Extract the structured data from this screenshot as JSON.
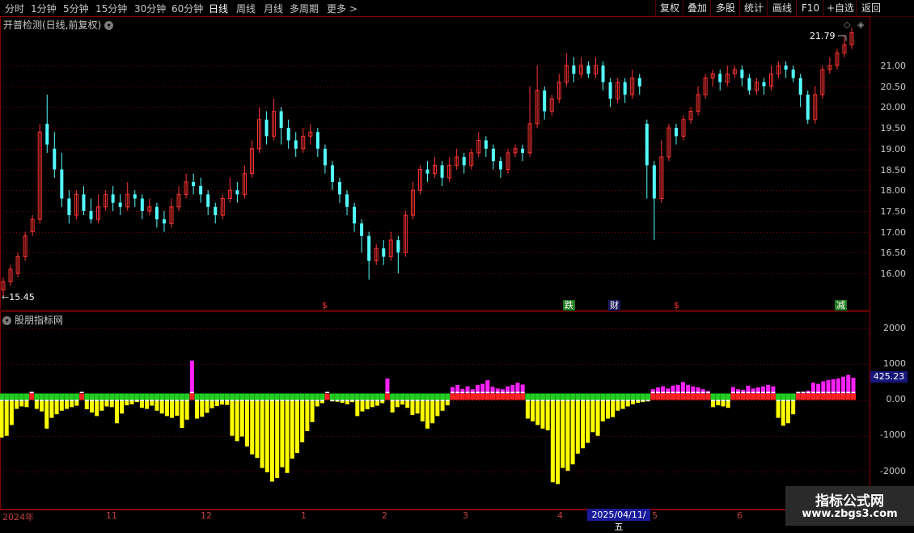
{
  "toolbar": {
    "periods": [
      "分时",
      "1分钟",
      "5分钟",
      "15分钟",
      "30分钟",
      "60分钟",
      "日线",
      "周线",
      "月线",
      "多周期",
      "更多 >"
    ],
    "active_period": "日线",
    "right_buttons": [
      "复权",
      "叠加",
      "多股",
      "统计",
      "画线",
      "F10",
      "+自选",
      "返回"
    ]
  },
  "main_panel": {
    "title": "开普检测(日线,前复权)",
    "high_label": "21.79",
    "low_label": "15.45",
    "price_axis": [
      "21.00",
      "20.50",
      "20.00",
      "19.50",
      "19.00",
      "18.50",
      "18.00",
      "17.50",
      "17.00",
      "16.50",
      "16.00"
    ],
    "markers": [
      {
        "text": "$",
        "color": "#ff3030",
        "bg": "none"
      },
      {
        "text": "跌",
        "color": "#ffffff",
        "bg": "#1f7a1f"
      },
      {
        "text": "财",
        "color": "#ffffff",
        "bg": "#1a1a5a"
      },
      {
        "text": "$",
        "color": "#ff3030",
        "bg": "none"
      },
      {
        "text": "减",
        "color": "#ffffff",
        "bg": "#1f7a1f"
      }
    ]
  },
  "sub_panel": {
    "title": "股朋指标网",
    "axis": [
      "2000",
      "1000",
      "0.00",
      "-1000",
      "-2000"
    ],
    "current_value": "425.23"
  },
  "date_axis": {
    "labels": [
      "2024年",
      "11",
      "12",
      "1",
      "2",
      "3",
      "4",
      "5",
      "6"
    ],
    "highlight": "2025/04/11/五"
  },
  "watermark": {
    "line1": "指标公式网",
    "line2": "www.zbgs3.com"
  },
  "colors": {
    "up": "#ff3333",
    "down": "#54ffff",
    "positive_bar": "#ff22ff",
    "negative_bar": "#ffff00",
    "band_red": "#ff2222",
    "band_green": "#22cc22",
    "grid": "#7a0000"
  },
  "chart_data": [
    {
      "type": "candlestick",
      "title": "开普检测(日线,前复权)",
      "ylim": [
        15.5,
        22.1
      ],
      "candles": [
        [
          15.6,
          15.8,
          15.45,
          15.9
        ],
        [
          15.8,
          16.1,
          15.7,
          16.2
        ],
        [
          16.0,
          16.4,
          15.9,
          16.5
        ],
        [
          16.4,
          16.9,
          16.3,
          17.0
        ],
        [
          17.0,
          17.3,
          16.9,
          17.4
        ],
        [
          17.3,
          19.4,
          17.2,
          19.6
        ],
        [
          19.6,
          19.1,
          18.9,
          20.3
        ],
        [
          19.0,
          18.5,
          18.3,
          19.4
        ],
        [
          18.5,
          17.8,
          17.6,
          18.9
        ],
        [
          17.8,
          17.4,
          17.2,
          18.0
        ],
        [
          17.4,
          17.9,
          17.3,
          18.0
        ],
        [
          17.9,
          17.5,
          17.4,
          18.1
        ],
        [
          17.5,
          17.3,
          17.2,
          17.8
        ],
        [
          17.3,
          17.6,
          17.2,
          17.9
        ],
        [
          17.6,
          17.9,
          17.5,
          18.0
        ],
        [
          17.9,
          17.7,
          17.5,
          18.1
        ],
        [
          17.7,
          17.6,
          17.4,
          17.9
        ],
        [
          17.6,
          17.9,
          17.5,
          18.2
        ],
        [
          17.9,
          17.8,
          17.6,
          18.0
        ],
        [
          17.8,
          17.5,
          17.3,
          17.9
        ],
        [
          17.5,
          17.6,
          17.4,
          17.8
        ],
        [
          17.6,
          17.3,
          17.1,
          17.7
        ],
        [
          17.3,
          17.2,
          17.0,
          17.5
        ],
        [
          17.2,
          17.6,
          17.1,
          17.8
        ],
        [
          17.6,
          17.9,
          17.5,
          18.1
        ],
        [
          17.9,
          18.2,
          17.8,
          18.4
        ],
        [
          18.2,
          18.1,
          17.9,
          18.4
        ],
        [
          18.1,
          17.9,
          17.7,
          18.3
        ],
        [
          17.9,
          17.6,
          17.4,
          18.0
        ],
        [
          17.6,
          17.4,
          17.2,
          17.7
        ],
        [
          17.4,
          17.8,
          17.3,
          17.9
        ],
        [
          17.8,
          18.0,
          17.7,
          18.3
        ],
        [
          18.0,
          17.9,
          17.7,
          18.2
        ],
        [
          17.9,
          18.4,
          17.8,
          18.6
        ],
        [
          18.4,
          19.0,
          18.3,
          19.2
        ],
        [
          19.0,
          19.7,
          18.9,
          20.0
        ],
        [
          19.7,
          19.3,
          19.1,
          19.9
        ],
        [
          19.3,
          19.9,
          19.2,
          20.2
        ],
        [
          19.9,
          19.5,
          19.1,
          20.0
        ],
        [
          19.5,
          19.2,
          19.0,
          19.7
        ],
        [
          19.2,
          19.0,
          18.8,
          19.4
        ],
        [
          19.0,
          19.3,
          18.9,
          19.5
        ],
        [
          19.3,
          19.4,
          19.1,
          19.6
        ],
        [
          19.4,
          19.0,
          18.8,
          19.5
        ],
        [
          19.0,
          18.6,
          18.4,
          19.1
        ],
        [
          18.6,
          18.2,
          18.0,
          18.7
        ],
        [
          18.2,
          17.9,
          17.7,
          18.3
        ],
        [
          17.9,
          17.6,
          17.4,
          18.0
        ],
        [
          17.6,
          17.2,
          17.0,
          17.7
        ],
        [
          17.2,
          16.9,
          16.5,
          17.3
        ],
        [
          16.9,
          16.3,
          15.85,
          17.0
        ],
        [
          16.3,
          16.6,
          16.2,
          16.7
        ],
        [
          16.6,
          16.4,
          16.2,
          16.8
        ],
        [
          16.4,
          16.8,
          16.3,
          17.0
        ],
        [
          16.8,
          16.5,
          16.0,
          16.9
        ],
        [
          16.5,
          17.4,
          16.4,
          17.5
        ],
        [
          17.4,
          18.0,
          17.3,
          18.2
        ],
        [
          18.0,
          18.5,
          17.9,
          18.6
        ],
        [
          18.5,
          18.4,
          18.2,
          18.7
        ],
        [
          18.4,
          18.6,
          18.3,
          18.8
        ],
        [
          18.6,
          18.3,
          18.1,
          18.7
        ],
        [
          18.3,
          18.6,
          18.2,
          18.8
        ],
        [
          18.6,
          18.8,
          18.5,
          19.0
        ],
        [
          18.8,
          18.6,
          18.4,
          18.9
        ],
        [
          18.6,
          18.9,
          18.5,
          19.0
        ],
        [
          18.9,
          19.2,
          18.8,
          19.4
        ],
        [
          19.2,
          19.0,
          18.8,
          19.3
        ],
        [
          19.0,
          18.7,
          18.5,
          19.1
        ],
        [
          18.7,
          18.5,
          18.3,
          18.8
        ],
        [
          18.5,
          18.9,
          18.4,
          19.0
        ],
        [
          18.9,
          19.0,
          18.8,
          19.1
        ],
        [
          19.0,
          18.9,
          18.7,
          19.1
        ],
        [
          18.9,
          19.6,
          18.8,
          20.5
        ],
        [
          19.6,
          20.4,
          19.5,
          21.0
        ],
        [
          20.4,
          19.9,
          19.7,
          20.5
        ],
        [
          19.9,
          20.2,
          19.8,
          20.3
        ],
        [
          20.2,
          20.6,
          20.1,
          20.8
        ],
        [
          20.6,
          21.0,
          20.5,
          21.3
        ],
        [
          21.0,
          20.8,
          20.6,
          21.2
        ],
        [
          20.8,
          21.0,
          20.7,
          21.2
        ],
        [
          21.0,
          20.8,
          20.7,
          21.1
        ],
        [
          20.8,
          21.0,
          20.7,
          21.2
        ],
        [
          21.0,
          20.6,
          20.4,
          21.1
        ],
        [
          20.6,
          20.2,
          20.0,
          20.7
        ],
        [
          20.2,
          20.6,
          20.1,
          20.7
        ],
        [
          20.6,
          20.3,
          20.1,
          20.7
        ],
        [
          20.3,
          20.7,
          20.2,
          20.9
        ],
        [
          20.7,
          20.5,
          20.3,
          20.8
        ],
        [
          19.6,
          18.6,
          17.8,
          19.7
        ],
        [
          18.6,
          17.8,
          16.8,
          18.7
        ],
        [
          17.8,
          18.8,
          17.7,
          19.2
        ],
        [
          18.8,
          19.5,
          18.7,
          19.6
        ],
        [
          19.5,
          19.3,
          19.1,
          19.6
        ],
        [
          19.3,
          19.7,
          19.2,
          19.8
        ],
        [
          19.7,
          19.9,
          19.6,
          20.0
        ],
        [
          19.9,
          20.3,
          19.8,
          20.5
        ],
        [
          20.3,
          20.7,
          20.2,
          20.8
        ],
        [
          20.7,
          20.8,
          20.5,
          20.9
        ],
        [
          20.8,
          20.6,
          20.4,
          20.9
        ],
        [
          20.6,
          20.8,
          20.5,
          21.0
        ],
        [
          20.8,
          20.9,
          20.7,
          21.0
        ],
        [
          20.9,
          20.7,
          20.5,
          21.0
        ],
        [
          20.7,
          20.4,
          20.3,
          20.8
        ],
        [
          20.4,
          20.6,
          20.3,
          20.7
        ],
        [
          20.6,
          20.5,
          20.3,
          20.7
        ],
        [
          20.5,
          20.8,
          20.4,
          21.0
        ],
        [
          20.8,
          21.0,
          20.7,
          21.1
        ],
        [
          21.0,
          20.9,
          20.7,
          21.1
        ],
        [
          20.9,
          20.7,
          20.6,
          21.0
        ],
        [
          20.7,
          20.3,
          20.0,
          20.8
        ],
        [
          20.3,
          19.7,
          19.6,
          20.4
        ],
        [
          19.7,
          20.3,
          19.6,
          20.5
        ],
        [
          20.3,
          20.9,
          20.2,
          21.0
        ],
        [
          20.9,
          21.0,
          20.8,
          21.2
        ],
        [
          21.0,
          21.3,
          20.9,
          21.4
        ],
        [
          21.3,
          21.5,
          21.2,
          21.7
        ],
        [
          21.5,
          21.79,
          21.4,
          21.9
        ]
      ]
    },
    {
      "type": "bar",
      "title": "股朋指标网",
      "ylim": [
        -2400,
        2100
      ],
      "values": [
        -1050,
        -1000,
        -700,
        -250,
        -180,
        -200,
        200,
        -250,
        -320,
        -800,
        -500,
        -400,
        -300,
        -250,
        -200,
        -160,
        100,
        -260,
        -350,
        -450,
        -300,
        -180,
        -200,
        -650,
        -380,
        -150,
        -120,
        -60,
        -220,
        -250,
        -160,
        -300,
        -380,
        -450,
        -500,
        -440,
        -780,
        -550,
        1100,
        -520,
        -470,
        -360,
        -230,
        -170,
        -130,
        -140,
        -1000,
        -1150,
        -1020,
        -1300,
        -1520,
        -1620,
        -1900,
        -2020,
        -2280,
        -2180,
        -1880,
        -2040,
        -1640,
        -1480,
        -1180,
        -870,
        -620,
        -180,
        -90,
        130,
        -40,
        -50,
        -80,
        -120,
        -60,
        -450,
        -320,
        -260,
        -200,
        -160,
        -90,
        600,
        -350,
        -200,
        -130,
        -220,
        -420,
        -380,
        -600,
        -800,
        -650,
        -450,
        -300,
        -150,
        360,
        420,
        310,
        380,
        300,
        420,
        450,
        550,
        370,
        320,
        300,
        380,
        420,
        480,
        430,
        -520,
        -600,
        -700,
        -800,
        -850,
        -2300,
        -2350,
        -1900,
        -1980,
        -1800,
        -1500,
        -1350,
        -1200,
        -900,
        -1000,
        -600,
        -520,
        -480,
        -300,
        -250,
        -180,
        -120,
        -80,
        -60,
        -40,
        300,
        350,
        380,
        320,
        400,
        420,
        500,
        420,
        380,
        350,
        300,
        250,
        -200,
        -150,
        -180,
        -220,
        360,
        300,
        280,
        400,
        320,
        350,
        380,
        420,
        380,
        -500,
        -720,
        -650,
        -400,
        200,
        230,
        260,
        480,
        450,
        520,
        560,
        580,
        600,
        650,
        700,
        620
      ]
    }
  ]
}
